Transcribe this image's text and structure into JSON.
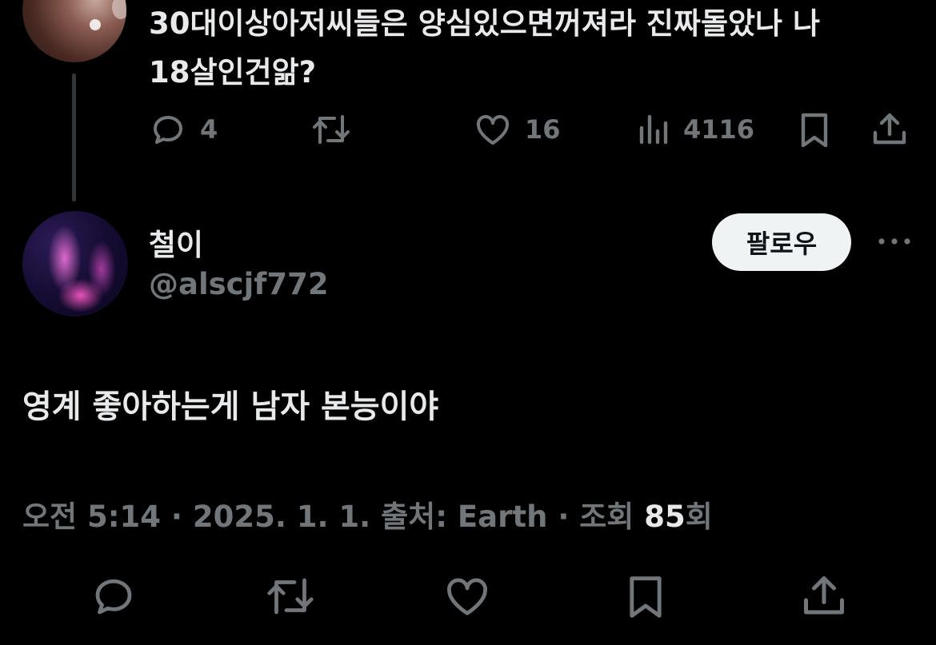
{
  "parent_tweet": {
    "text_line1": "30대이상아저씨들은 양심있으면꺼져라 진짜돌았나 나",
    "text_line2": "18살인건앎?",
    "actions": {
      "replies": "4",
      "retweets": "",
      "likes": "16",
      "views": "4116"
    },
    "icons": [
      "reply-icon",
      "retweet-icon",
      "like-icon",
      "views-icon",
      "bookmark-icon",
      "share-icon"
    ]
  },
  "main_tweet": {
    "display_name": "철이",
    "handle": "@alscjf772",
    "follow_label": "팔로우",
    "body": "영계 좋아하는게 남자 본능이야",
    "meta": {
      "time": "오전 5:14",
      "separator": "·",
      "date": "2025. 1. 1.",
      "source_label": "출처: Earth",
      "views_label": "조회",
      "views_count": "85",
      "views_suffix": "회"
    },
    "icons": [
      "reply-icon",
      "retweet-icon",
      "like-icon",
      "bookmark-icon",
      "share-icon",
      "more-icon"
    ]
  },
  "colors": {
    "background": "#000000",
    "text_primary": "#e7e9ea",
    "text_secondary": "#71767b",
    "follow_button_bg": "#eff3f4",
    "thread_line": "#333639"
  }
}
